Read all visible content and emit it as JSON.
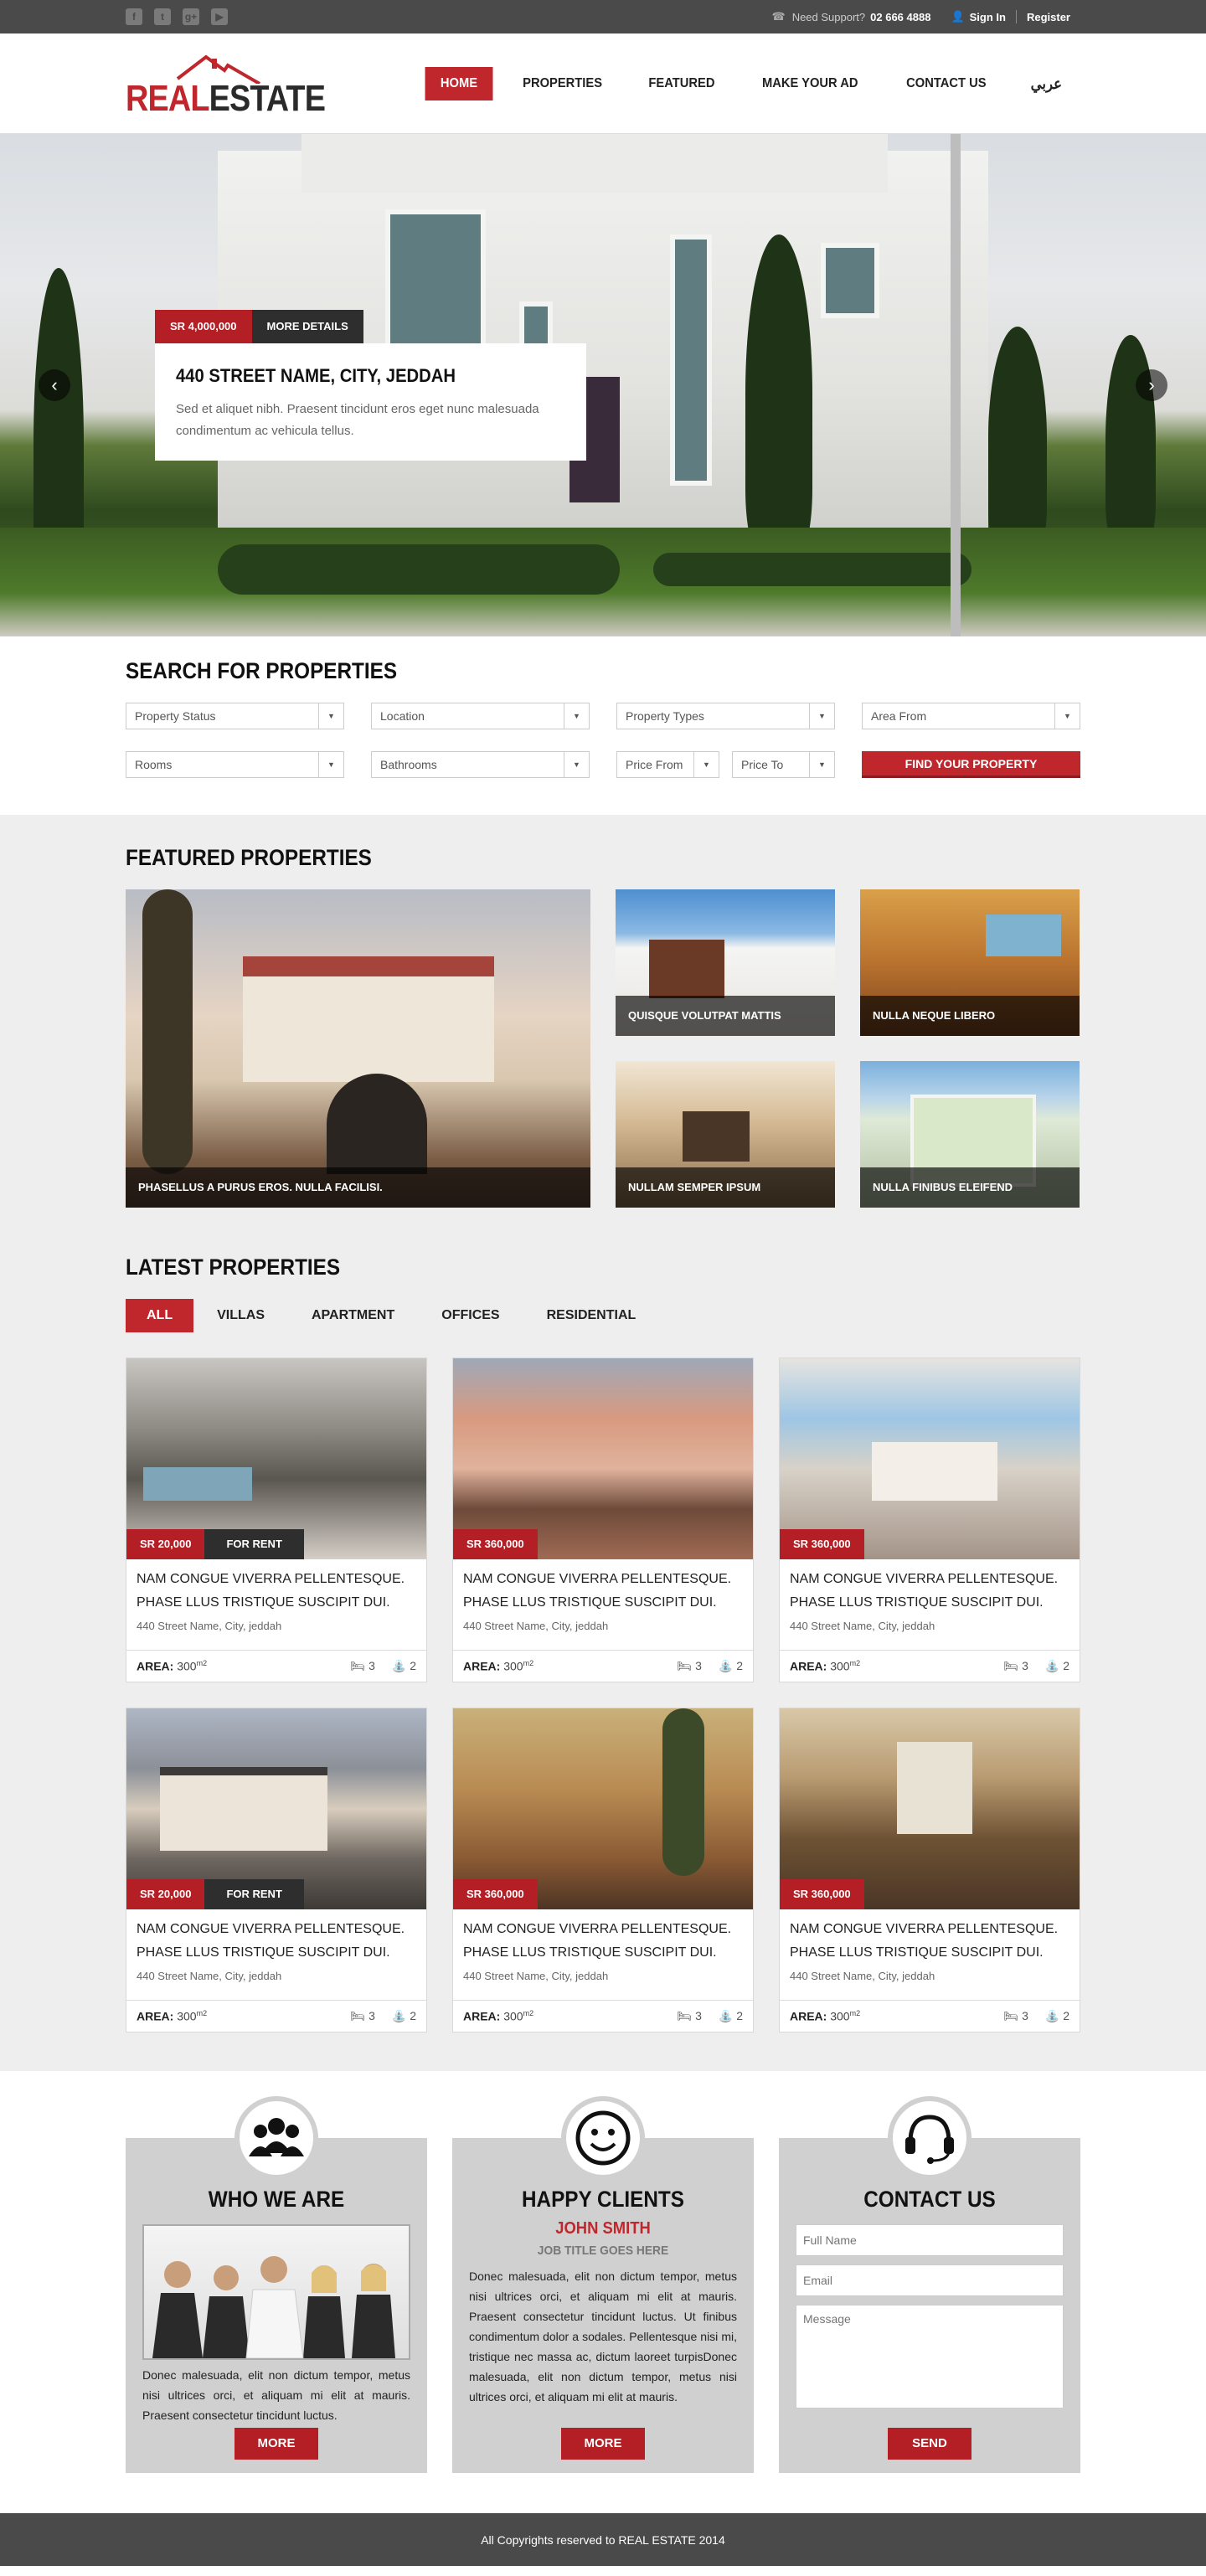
{
  "topbar": {
    "socials": [
      "facebook-icon",
      "twitter-icon",
      "google-plus-icon",
      "youtube-icon"
    ],
    "support_label": "Need Support?",
    "support_phone": "02 666 4888",
    "signin": "Sign In",
    "register": "Register"
  },
  "header": {
    "logo_real": "REAL",
    "logo_estate": "ESTATE",
    "nav": [
      "HOME",
      "PROPERTIES",
      "FEATURED",
      "MAKE YOUR AD",
      "CONTACT US",
      "عربي"
    ]
  },
  "hero": {
    "price": "SR 4,000,000",
    "details": "MORE DETAILS",
    "title": "440 STREET NAME, CITY, JEDDAH",
    "description": "Sed et aliquet nibh. Praesent tincidunt eros eget nunc malesuada condimentum ac vehicula tellus."
  },
  "search": {
    "title": "SEARCH FOR PROPERTIES",
    "row1": [
      "Property Status",
      "Location",
      "Property Types",
      "Area From"
    ],
    "row2": [
      "Rooms",
      "Bathrooms"
    ],
    "price_from": "Price From",
    "price_to": "Price To",
    "button": "FIND YOUR PROPERTY"
  },
  "featured": {
    "title": "FEATURED PROPERTIES",
    "items": [
      "PHASELLUS A PURUS EROS. NULLA FACILISI.",
      "QUISQUE VOLUTPAT MATTIS",
      "NULLA NEQUE LIBERO",
      "NULLAM SEMPER IPSUM",
      "NULLA FINIBUS ELEIFEND"
    ]
  },
  "latest": {
    "title": "LATEST PROPERTIES",
    "tabs": [
      "ALL",
      "VILLAS",
      "APARTMENT",
      "OFFICES",
      "RESIDENTIAL"
    ],
    "cards": [
      {
        "price": "SR 20,000",
        "rent": "FOR RENT",
        "title": "NAM CONGUE VIVERRA PELLENTESQUE. PHASE LLUS TRISTIQUE SUSCIPIT DUI.",
        "address": "440 Street Name, City, jeddah",
        "area_label": "AREA:",
        "area": "300",
        "unit": "m2",
        "beds": "3",
        "baths": "2"
      },
      {
        "price": "SR 360,000",
        "rent": "",
        "title": "NAM CONGUE VIVERRA PELLENTESQUE. PHASE LLUS TRISTIQUE SUSCIPIT DUI.",
        "address": "440 Street Name, City, jeddah",
        "area_label": "AREA:",
        "area": "300",
        "unit": "m2",
        "beds": "3",
        "baths": "2"
      },
      {
        "price": "SR 360,000",
        "rent": "",
        "title": "NAM CONGUE VIVERRA PELLENTESQUE. PHASE LLUS TRISTIQUE SUSCIPIT DUI.",
        "address": "440 Street Name, City, jeddah",
        "area_label": "AREA:",
        "area": "300",
        "unit": "m2",
        "beds": "3",
        "baths": "2"
      },
      {
        "price": "SR 20,000",
        "rent": "FOR RENT",
        "title": "NAM CONGUE VIVERRA PELLENTESQUE. PHASE LLUS TRISTIQUE SUSCIPIT DUI.",
        "address": "440 Street Name, City, jeddah",
        "area_label": "AREA:",
        "area": "300",
        "unit": "m2",
        "beds": "3",
        "baths": "2"
      },
      {
        "price": "SR 360,000",
        "rent": "",
        "title": "NAM CONGUE VIVERRA PELLENTESQUE. PHASE LLUS TRISTIQUE SUSCIPIT DUI.",
        "address": "440 Street Name, City, jeddah",
        "area_label": "AREA:",
        "area": "300",
        "unit": "m2",
        "beds": "3",
        "baths": "2"
      },
      {
        "price": "SR 360,000",
        "rent": "",
        "title": "NAM CONGUE VIVERRA PELLENTESQUE. PHASE LLUS TRISTIQUE SUSCIPIT DUI.",
        "address": "440 Street Name, City, jeddah",
        "area_label": "AREA:",
        "area": "300",
        "unit": "m2",
        "beds": "3",
        "baths": "2"
      }
    ]
  },
  "about": {
    "title": "WHO WE ARE",
    "text": "Donec malesuada, elit non dictum tempor, metus nisi ultrices orci, et aliquam mi elit at mauris. Praesent consectetur tincidunt luctus.",
    "button": "MORE"
  },
  "clients": {
    "title": "HAPPY CLIENTS",
    "name": "JOHN SMITH",
    "job": "JOB TITLE GOES HERE",
    "text": "Donec malesuada, elit non dictum tempor, metus nisi ultrices orci, et aliquam mi elit at mauris. Praesent consectetur tincidunt luctus. Ut finibus condimentum dolor a sodales. Pellentesque nisi mi, tristique nec massa ac, dictum laoreet turpisDonec malesuada, elit non dictum tempor, metus nisi ultrices orci, et aliquam mi elit at mauris.",
    "button": "MORE"
  },
  "contact": {
    "title": "CONTACT US",
    "name_ph": "Full Name",
    "email_ph": "Email",
    "msg_ph": "Message",
    "button": "SEND"
  },
  "footer": {
    "text": "All Copyrights reserved to REAL ESTATE 2014"
  },
  "colors": {
    "accent": "#c0272d",
    "dark_bar": "#4a4a4a",
    "grey_bg": "#eeeeee",
    "box_bg": "#d0d0d0"
  }
}
